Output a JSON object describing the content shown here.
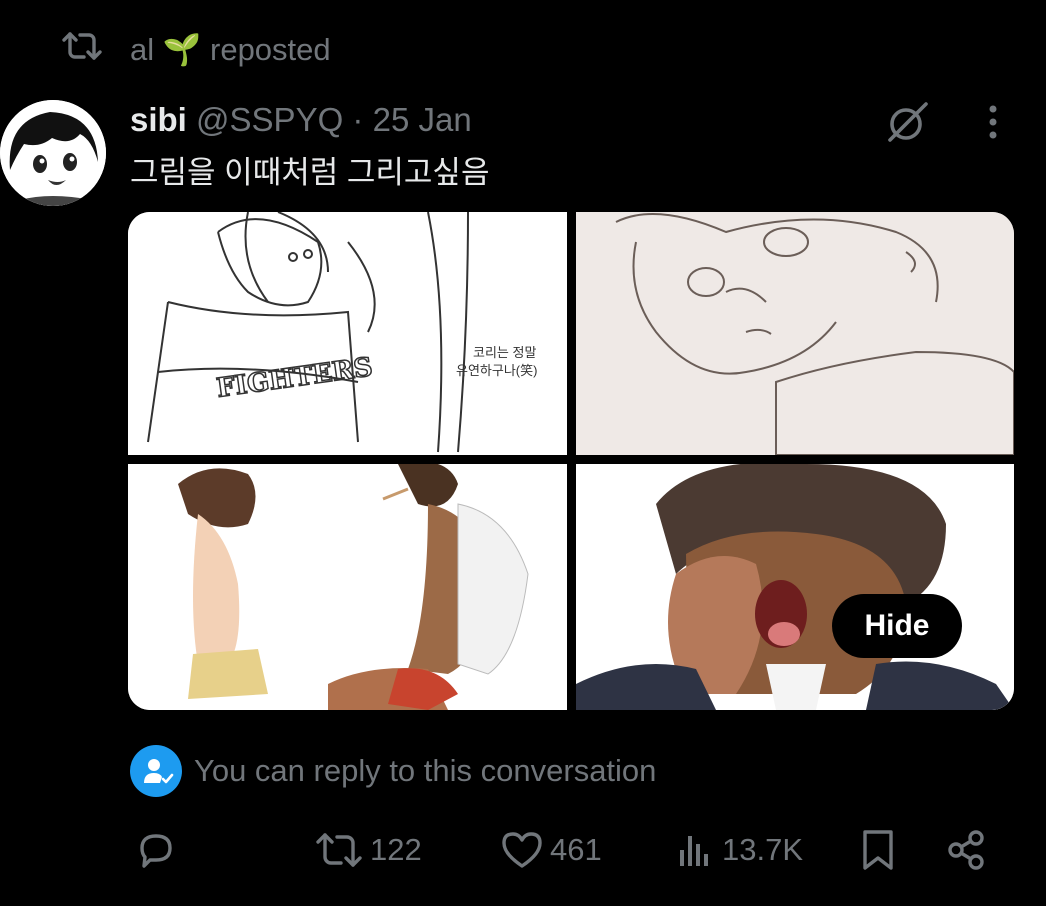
{
  "repost": {
    "user": "al",
    "emoji": "🌱",
    "label": "reposted"
  },
  "tweet": {
    "display_name": "sibi",
    "handle": "@SSPYQ",
    "separator": "·",
    "date": "25 Jan",
    "text": "그림을 이때처럼 그리고싶음",
    "media_count": 4,
    "sketch_caption_line1": "코리는 정말",
    "sketch_caption_line2": "유연하구나(笑)",
    "jersey_text": "FIGHTERS"
  },
  "media": {
    "hide_label": "Hide"
  },
  "reply_restriction": {
    "text": "You can reply to this conversation"
  },
  "actions": {
    "retweets": "122",
    "likes": "461",
    "views": "13.7K"
  },
  "icons": {
    "repost": "repost-icon",
    "grok": "grok-icon",
    "more": "more-icon",
    "reply": "reply-icon",
    "retweet": "retweet-icon",
    "like": "heart-icon",
    "views": "views-icon",
    "bookmark": "bookmark-icon",
    "share": "share-icon"
  },
  "colors": {
    "background": "#000000",
    "text": "#e7e9ea",
    "muted": "#71767b",
    "accent": "#1d9bf0"
  }
}
